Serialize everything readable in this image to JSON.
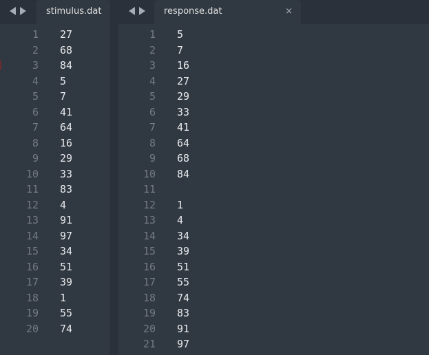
{
  "left_pane": {
    "tab_label": "stimulus.dat",
    "lines": [
      {
        "n": "1",
        "v": "27"
      },
      {
        "n": "2",
        "v": "68"
      },
      {
        "n": "3",
        "v": "84"
      },
      {
        "n": "4",
        "v": "5"
      },
      {
        "n": "5",
        "v": "7"
      },
      {
        "n": "6",
        "v": "41"
      },
      {
        "n": "7",
        "v": "64"
      },
      {
        "n": "8",
        "v": "16"
      },
      {
        "n": "9",
        "v": "29"
      },
      {
        "n": "10",
        "v": "33"
      },
      {
        "n": "11",
        "v": "83"
      },
      {
        "n": "12",
        "v": "4"
      },
      {
        "n": "13",
        "v": "91"
      },
      {
        "n": "14",
        "v": "97"
      },
      {
        "n": "15",
        "v": "34"
      },
      {
        "n": "16",
        "v": "51"
      },
      {
        "n": "17",
        "v": "39"
      },
      {
        "n": "18",
        "v": "1"
      },
      {
        "n": "19",
        "v": "55"
      },
      {
        "n": "20",
        "v": "74"
      }
    ]
  },
  "right_pane": {
    "tab_label": "response.dat",
    "close_glyph": "×",
    "lines": [
      {
        "n": "1",
        "v": "5"
      },
      {
        "n": "2",
        "v": "7"
      },
      {
        "n": "3",
        "v": "16"
      },
      {
        "n": "4",
        "v": "27"
      },
      {
        "n": "5",
        "v": "29"
      },
      {
        "n": "6",
        "v": "33"
      },
      {
        "n": "7",
        "v": "41"
      },
      {
        "n": "8",
        "v": "64"
      },
      {
        "n": "9",
        "v": "68"
      },
      {
        "n": "10",
        "v": "84"
      },
      {
        "n": "11",
        "v": ""
      },
      {
        "n": "12",
        "v": "1"
      },
      {
        "n": "13",
        "v": "4"
      },
      {
        "n": "14",
        "v": "34"
      },
      {
        "n": "15",
        "v": "39"
      },
      {
        "n": "16",
        "v": "51"
      },
      {
        "n": "17",
        "v": "55"
      },
      {
        "n": "18",
        "v": "74"
      },
      {
        "n": "19",
        "v": "83"
      },
      {
        "n": "20",
        "v": "91"
      },
      {
        "n": "21",
        "v": "97"
      }
    ]
  },
  "icons": {
    "nav_back": "chevron-left-icon",
    "nav_forward": "chevron-right-icon",
    "close": "close-icon"
  },
  "colors": {
    "background": "#2b313a",
    "editor": "#303841",
    "text": "#e9ebee",
    "gutter": "#747b86"
  }
}
